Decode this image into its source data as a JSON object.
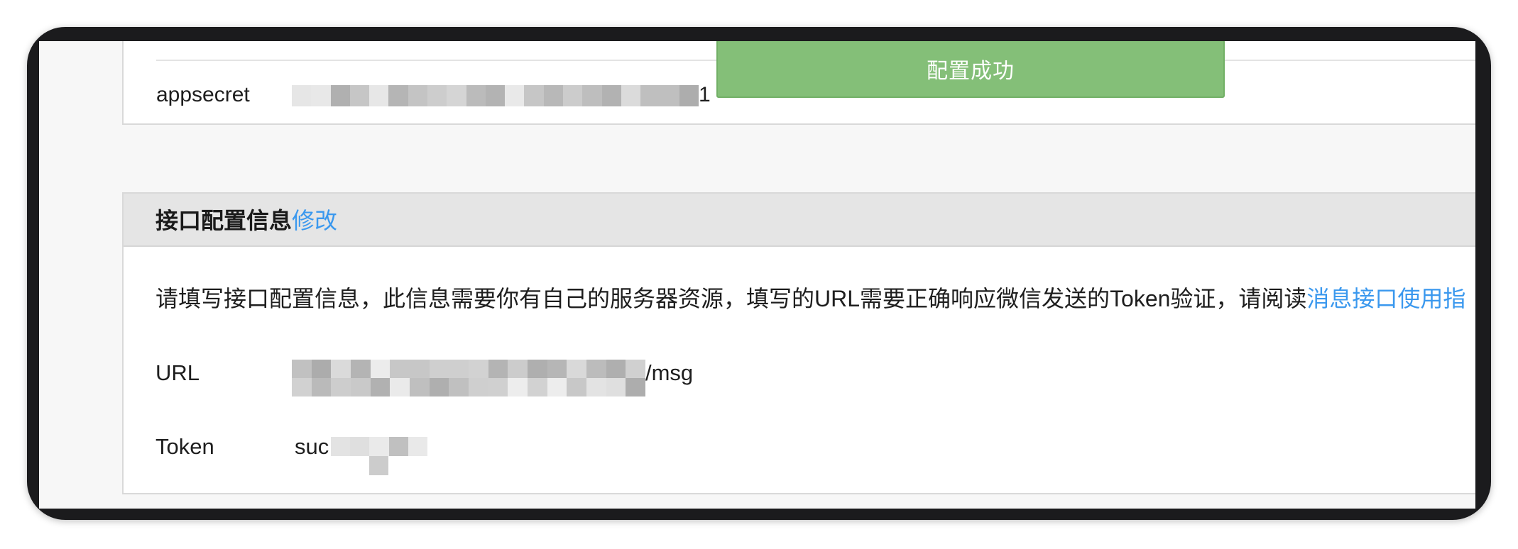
{
  "top_card": {
    "appsecret_label": "appsecret",
    "appsecret_visible_suffix": "1"
  },
  "toast": {
    "message": "配置成功"
  },
  "interface_config": {
    "title": "接口配置信息",
    "edit_link": "修改",
    "description": "请填写接口配置信息，此信息需要你有自己的服务器资源，填写的URL需要正确响应微信发送的Token验证，请阅读",
    "guide_link": "消息接口使用指",
    "url_label": "URL",
    "url_visible_suffix": "/msg",
    "token_label": "Token",
    "token_visible_prefix": "suc"
  },
  "colors": {
    "link": "#3a98ee",
    "toast": "#84bf78",
    "header_bg": "#e5e5e5"
  }
}
